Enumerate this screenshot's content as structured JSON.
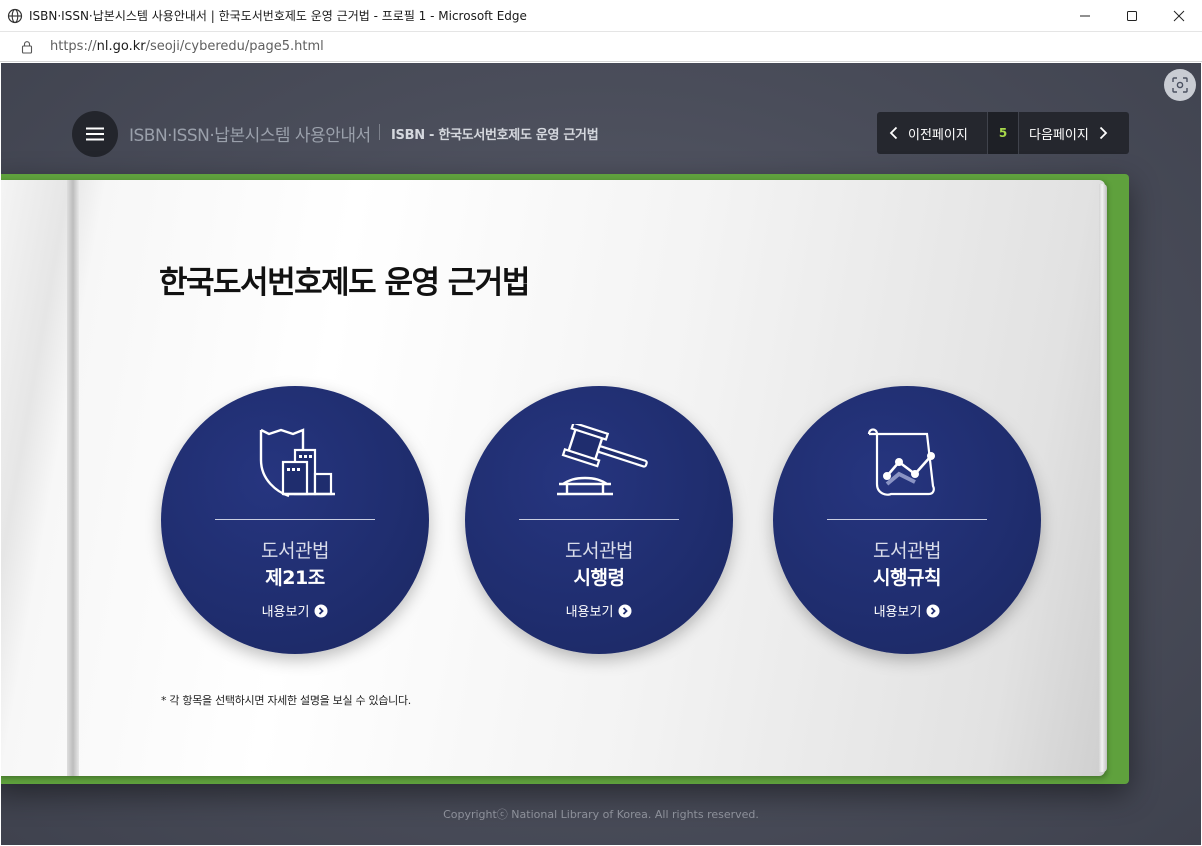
{
  "window": {
    "title": "ISBN·ISSN·납본시스템 사용안내서 | 한국도서번호제도 운영 근거법 - 프로필 1 - Microsoft Edge"
  },
  "address": {
    "url_prefix": "https://",
    "url_domain": "nl.go.kr",
    "url_path": "/seoji/cyberedu/page5.html"
  },
  "header": {
    "site_title": "ISBN·ISSN·납본시스템 사용안내서",
    "section_title": "ISBN - 한국도서번호제도 운영 근거법"
  },
  "pager": {
    "prev_label": "이전페이지",
    "current_page": "5",
    "next_label": "다음페이지"
  },
  "page": {
    "heading": "한국도서번호제도 운영 근거법",
    "cards": [
      {
        "law": "도서관법",
        "article": "제21조",
        "link": "내용보기",
        "icon": "shield-building-icon"
      },
      {
        "law": "도서관법",
        "article": "시행령",
        "link": "내용보기",
        "icon": "gavel-icon"
      },
      {
        "law": "도서관법",
        "article": "시행규칙",
        "link": "내용보기",
        "icon": "scroll-chart-icon"
      }
    ],
    "footnote": "* 각 항목을 선택하시면 자세한 설명을 보실 수 있습니다."
  },
  "footer": {
    "copyright": "Copyrightⓒ National Library of Korea. All rights reserved."
  },
  "colors": {
    "circle": "#1f2d6e",
    "book_cover": "#5fa13d",
    "page_number": "#a7d84a"
  }
}
